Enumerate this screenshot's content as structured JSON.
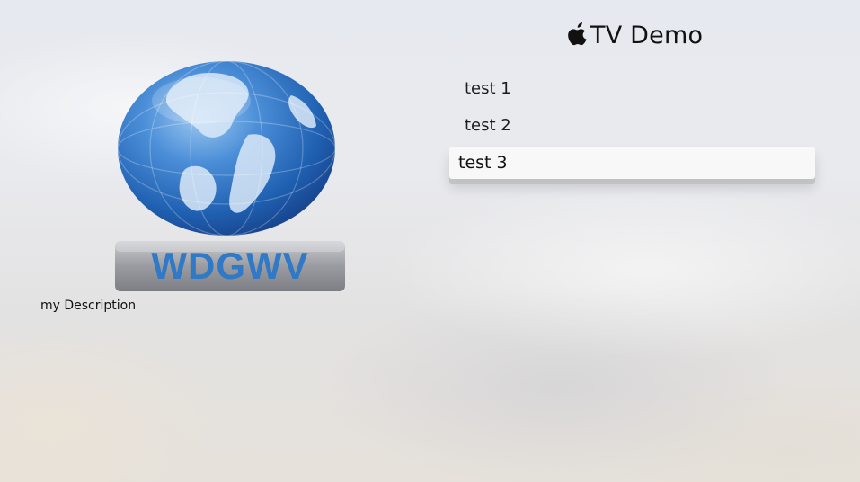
{
  "header": {
    "title": "TV Demo",
    "brand_icon": "apple-icon"
  },
  "menu": {
    "items": [
      {
        "label": "test 1",
        "focused": false
      },
      {
        "label": "test 2",
        "focused": false
      },
      {
        "label": "test 3",
        "focused": true
      }
    ]
  },
  "detail": {
    "logo_text": "WDGWV",
    "logo_icon": "globe-icon",
    "description": "my Description"
  },
  "colors": {
    "logo_text": "#2f79c6",
    "focus_background": "#f8f8f8",
    "globe_blue": "#1f5fb0"
  }
}
